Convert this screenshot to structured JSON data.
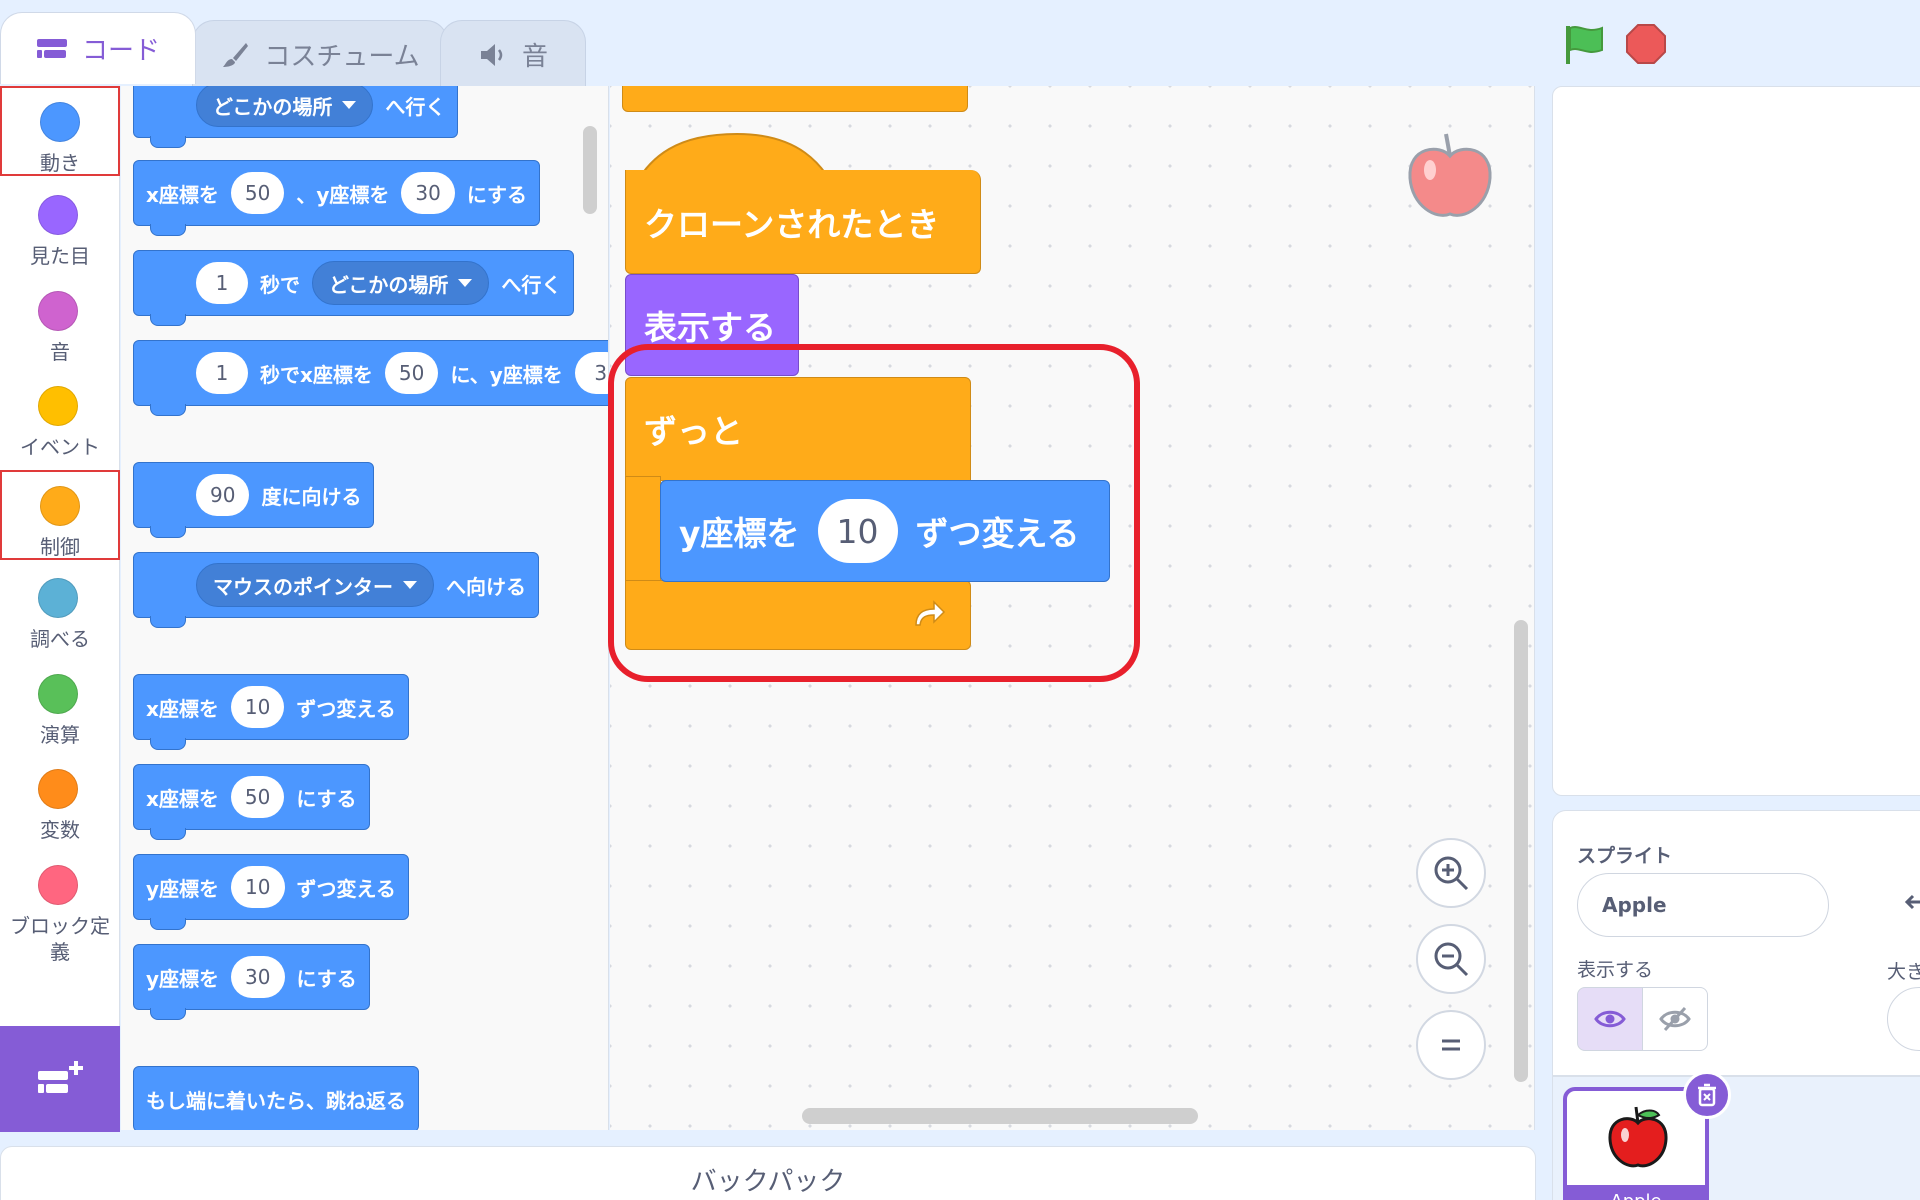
{
  "tabs": [
    {
      "label": "コード",
      "icon": "code-icon"
    },
    {
      "label": "コスチューム",
      "icon": "brush-icon"
    },
    {
      "label": "音",
      "icon": "speaker-icon"
    }
  ],
  "categories": [
    {
      "label": "動き",
      "color": "#4c97ff"
    },
    {
      "label": "見た目",
      "color": "#9966ff"
    },
    {
      "label": "音",
      "color": "#cf63cf"
    },
    {
      "label": "イベント",
      "color": "#ffbf00"
    },
    {
      "label": "制御",
      "color": "#ffab19"
    },
    {
      "label": "調べる",
      "color": "#5cb1d6"
    },
    {
      "label": "演算",
      "color": "#59c059"
    },
    {
      "label": "変数",
      "color": "#ff8c1a"
    },
    {
      "label": "ブロック定義",
      "color": "#ff6680"
    }
  ],
  "palette": {
    "goto": {
      "dropdown": "どこかの場所",
      "suffix": "へ行く"
    },
    "gotoxy": {
      "p1": "x座標を",
      "x": "50",
      "p2": "、y座標を",
      "y": "30",
      "p3": "にする"
    },
    "glide": {
      "secs": "1",
      "p1": "秒で",
      "dropdown": "どこかの場所",
      "p2": "へ行く"
    },
    "glidexy": {
      "secs": "1",
      "p1": "秒でx座標を",
      "x": "50",
      "p2": "に、y座標を",
      "y": "3"
    },
    "point": {
      "deg": "90",
      "p1": "度に向ける"
    },
    "pointto": {
      "dropdown": "マウスのポインター",
      "p1": "へ向ける"
    },
    "changex": {
      "p1": "x座標を",
      "v": "10",
      "p2": "ずつ変える"
    },
    "setx": {
      "p1": "x座標を",
      "v": "50",
      "p2": "にする"
    },
    "changey": {
      "p1": "y座標を",
      "v": "10",
      "p2": "ずつ変える"
    },
    "sety": {
      "p1": "y座標を",
      "v": "30",
      "p2": "にする"
    },
    "bounce": {
      "label": "もし端に着いたら、跳ね返る"
    }
  },
  "script": {
    "hat": "クローンされたとき",
    "show": "表示する",
    "forever": "ずっと",
    "changey": {
      "p1": "y座標を",
      "v": "10",
      "p2": "ずつ変える"
    }
  },
  "backpack": {
    "label": "バックパック"
  },
  "sprite_info": {
    "label_sprite": "スプライト",
    "sprite_name": "Apple",
    "label_show": "表示する",
    "label_size": "大き"
  },
  "sprite_tile": {
    "name": "Apple"
  }
}
